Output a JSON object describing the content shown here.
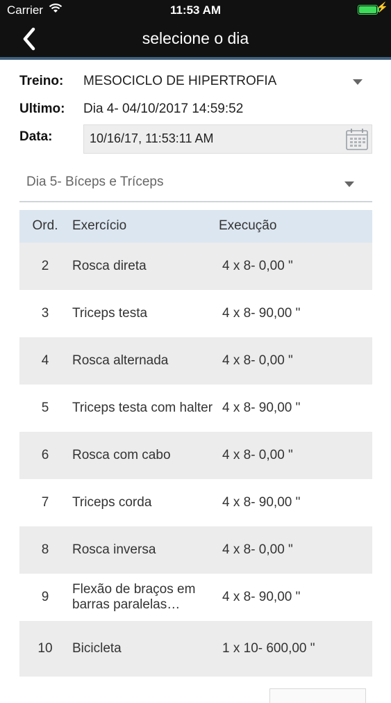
{
  "status": {
    "carrier": "Carrier",
    "time": "11:53 AM"
  },
  "nav": {
    "title": "selecione o dia"
  },
  "form": {
    "treino_label": "Treino:",
    "treino_value": "MESOCICLO DE HIPERTROFIA",
    "ultimo_label": "Ultimo:",
    "ultimo_value": "Dia 4- 04/10/2017 14:59:52",
    "data_label": "Data:",
    "data_value": "10/16/17, 11:53:11 AM"
  },
  "day_select": {
    "value": "Dia 5- Bíceps e Tríceps"
  },
  "table": {
    "headers": {
      "ord": "Ord.",
      "exercicio": "Exercício",
      "execucao": "Execução"
    },
    "rows": [
      {
        "ord": "2",
        "exercicio": "Rosca direta",
        "execucao": "4 x 8- 0,00 \""
      },
      {
        "ord": "3",
        "exercicio": "Triceps testa",
        "execucao": "4 x 8- 90,00 \""
      },
      {
        "ord": "4",
        "exercicio": "Rosca alternada",
        "execucao": "4 x 8- 0,00 \""
      },
      {
        "ord": "5",
        "exercicio": "Triceps testa com halter",
        "execucao": "4 x 8- 90,00 \""
      },
      {
        "ord": "6",
        "exercicio": "Rosca com cabo",
        "execucao": "4 x 8- 0,00 \""
      },
      {
        "ord": "7",
        "exercicio": "Triceps corda",
        "execucao": "4 x 8- 90,00 \""
      },
      {
        "ord": "8",
        "exercicio": "Rosca inversa",
        "execucao": "4 x 8- 0,00 \""
      },
      {
        "ord": "9",
        "exercicio": "Flexão de braços em barras paralelas (Tríceps)",
        "execucao": "4 x 8- 90,00 \""
      },
      {
        "ord": "10",
        "exercicio": "Bicicleta",
        "execucao": "1 x 10- 600,00 \""
      }
    ]
  },
  "colors": {
    "topbar": "#111111",
    "accent": "#3f5f7d",
    "header_bg": "#dce6f0",
    "row_alt": "#ececec",
    "battery": "#3ddc5a"
  },
  "icons": [
    "wifi-icon",
    "battery-icon",
    "back-chevron-icon",
    "dropdown-caret-icon",
    "calendar-icon"
  ]
}
